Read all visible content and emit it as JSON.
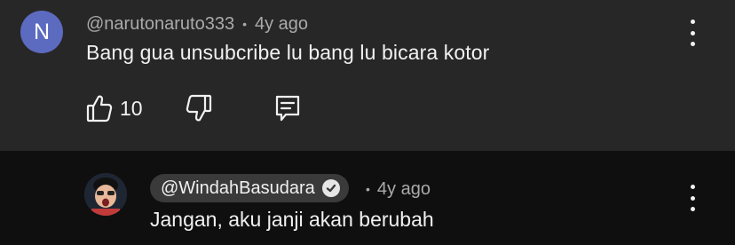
{
  "comment": {
    "avatar_letter": "N",
    "avatar_color": "#5c6bc0",
    "author": "@narutonaruto333",
    "separator": "•",
    "time": "4y ago",
    "text": "Bang gua unsubcribe lu bang lu bicara kotor",
    "like_count": "10",
    "icons": {
      "like": "thumb-up-icon",
      "dislike": "thumb-down-icon",
      "reply": "comment-reply-icon",
      "more": "more-vertical-icon"
    }
  },
  "reply": {
    "author": "@WindahBasudara",
    "verified_icon": "verified-check-icon",
    "separator": "•",
    "time": "4y ago",
    "text": "Jangan, aku janji akan berubah",
    "icons": {
      "more": "more-vertical-icon"
    }
  },
  "colors": {
    "comment_bg": "#272727",
    "reply_bg": "#0f0f0f",
    "pill_bg": "#3a3a3a",
    "secondary_text": "#aaaaaa",
    "primary_text": "#f1f1f1"
  }
}
